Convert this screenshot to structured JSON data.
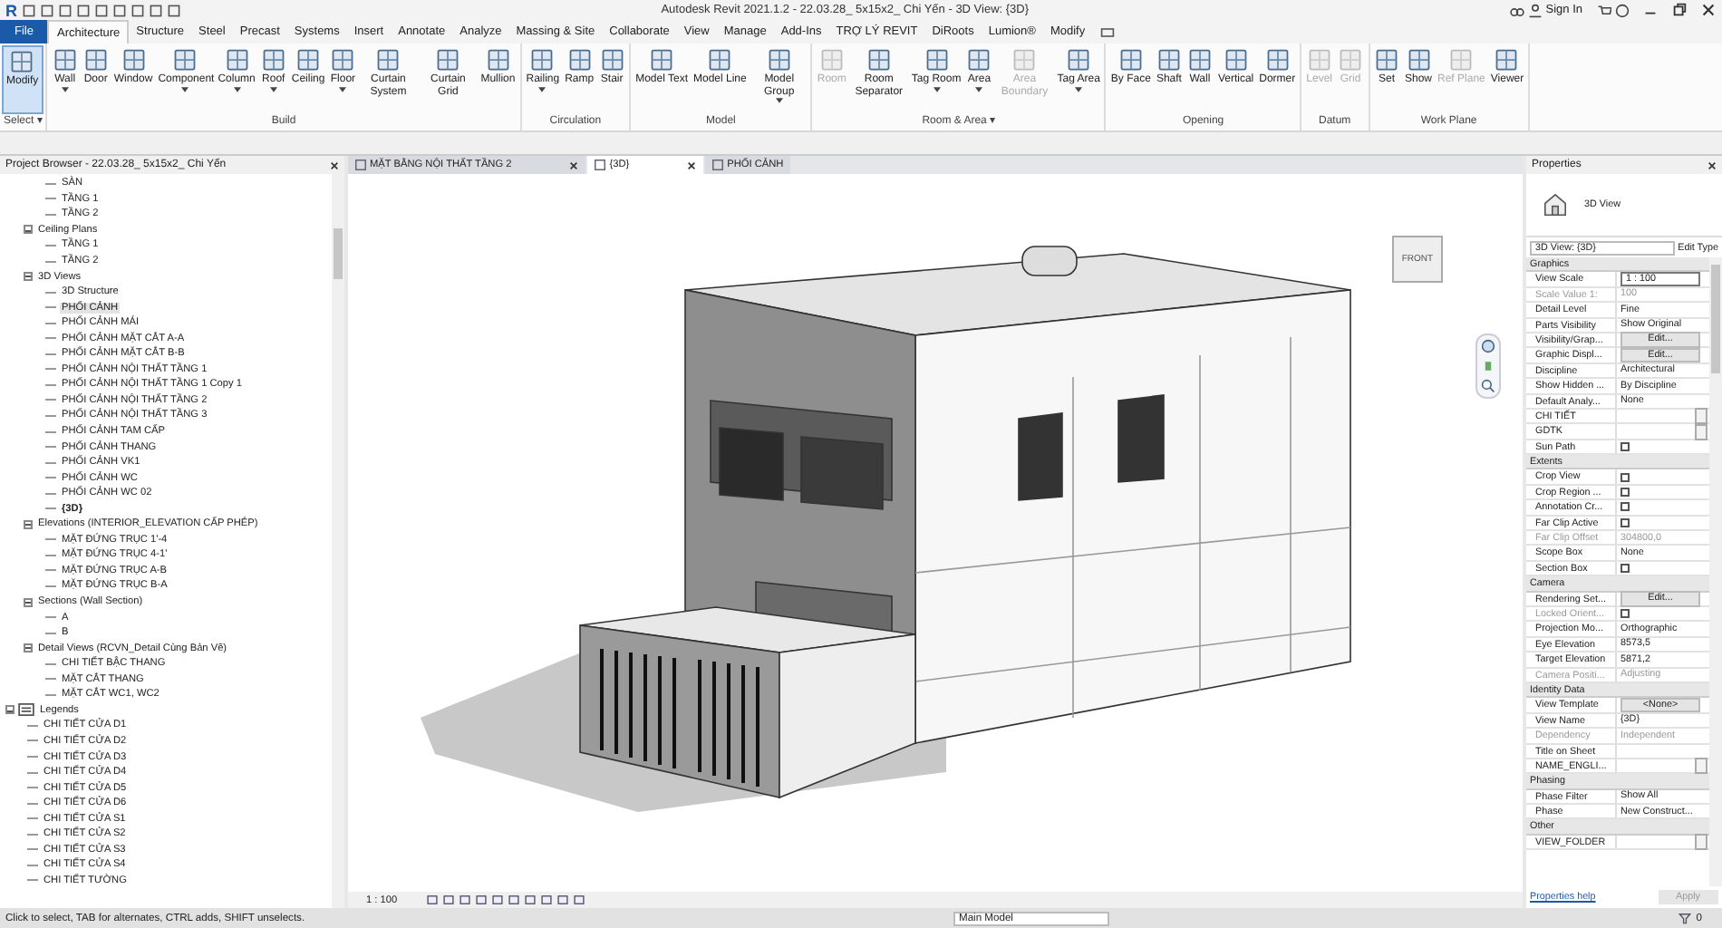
{
  "title_bar": {
    "logo": "R",
    "title": "Autodesk Revit 2021.1.2 - 22.03.28_ 5x15x2_ Chi Yến - 3D View: {3D}",
    "sign_in": "Sign In"
  },
  "menu_tabs": [
    {
      "label": "File",
      "kind": "file",
      "selected": false
    },
    {
      "label": "Architecture",
      "kind": "tab",
      "selected": true
    },
    {
      "label": "Structure",
      "kind": "tab",
      "selected": false
    },
    {
      "label": "Steel",
      "kind": "tab",
      "selected": false
    },
    {
      "label": "Precast",
      "kind": "tab",
      "selected": false
    },
    {
      "label": "Systems",
      "kind": "tab",
      "selected": false
    },
    {
      "label": "Insert",
      "kind": "tab",
      "selected": false
    },
    {
      "label": "Annotate",
      "kind": "tab",
      "selected": false
    },
    {
      "label": "Analyze",
      "kind": "tab",
      "selected": false
    },
    {
      "label": "Massing & Site",
      "kind": "tab",
      "selected": false
    },
    {
      "label": "Collaborate",
      "kind": "tab",
      "selected": false
    },
    {
      "label": "View",
      "kind": "tab",
      "selected": false
    },
    {
      "label": "Manage",
      "kind": "tab",
      "selected": false
    },
    {
      "label": "Add-Ins",
      "kind": "tab",
      "selected": false
    },
    {
      "label": "TRỢ LÝ REVIT",
      "kind": "tab",
      "selected": false
    },
    {
      "label": "DiRoots",
      "kind": "tab",
      "selected": false
    },
    {
      "label": "Lumion®",
      "kind": "tab",
      "selected": false
    },
    {
      "label": "Modify",
      "kind": "tab",
      "selected": false
    }
  ],
  "ribbon": [
    {
      "title": "Select ▾",
      "tools": [
        {
          "label": "Modify",
          "disabled": false,
          "dropdown": false,
          "selected": true
        }
      ]
    },
    {
      "title": "Build",
      "tools": [
        {
          "label": "Wall",
          "disabled": false,
          "dropdown": true,
          "selected": false
        },
        {
          "label": "Door",
          "disabled": false,
          "dropdown": false,
          "selected": false
        },
        {
          "label": "Window",
          "disabled": false,
          "dropdown": false,
          "selected": false
        },
        {
          "label": "Component",
          "disabled": false,
          "dropdown": true,
          "selected": false
        },
        {
          "label": "Column",
          "disabled": false,
          "dropdown": true,
          "selected": false
        },
        {
          "label": "Roof",
          "disabled": false,
          "dropdown": true,
          "selected": false
        },
        {
          "label": "Ceiling",
          "disabled": false,
          "dropdown": false,
          "selected": false
        },
        {
          "label": "Floor",
          "disabled": false,
          "dropdown": true,
          "selected": false
        },
        {
          "label": "Curtain System",
          "disabled": false,
          "dropdown": false,
          "selected": false
        },
        {
          "label": "Curtain Grid",
          "disabled": false,
          "dropdown": false,
          "selected": false
        },
        {
          "label": "Mullion",
          "disabled": false,
          "dropdown": false,
          "selected": false
        }
      ]
    },
    {
      "title": "Circulation",
      "tools": [
        {
          "label": "Railing",
          "disabled": false,
          "dropdown": true,
          "selected": false
        },
        {
          "label": "Ramp",
          "disabled": false,
          "dropdown": false,
          "selected": false
        },
        {
          "label": "Stair",
          "disabled": false,
          "dropdown": false,
          "selected": false
        }
      ]
    },
    {
      "title": "Model",
      "tools": [
        {
          "label": "Model Text",
          "disabled": false,
          "dropdown": false,
          "selected": false
        },
        {
          "label": "Model Line",
          "disabled": false,
          "dropdown": false,
          "selected": false
        },
        {
          "label": "Model Group",
          "disabled": false,
          "dropdown": true,
          "selected": false
        }
      ]
    },
    {
      "title": "Room & Area ▾",
      "tools": [
        {
          "label": "Room",
          "disabled": true,
          "dropdown": false,
          "selected": false
        },
        {
          "label": "Room Separator",
          "disabled": false,
          "dropdown": false,
          "selected": false
        },
        {
          "label": "Tag Room",
          "disabled": false,
          "dropdown": true,
          "selected": false
        },
        {
          "label": "Area",
          "disabled": false,
          "dropdown": true,
          "selected": false
        },
        {
          "label": "Area Boundary",
          "disabled": true,
          "dropdown": false,
          "selected": false
        },
        {
          "label": "Tag Area",
          "disabled": false,
          "dropdown": true,
          "selected": false
        }
      ]
    },
    {
      "title": "Opening",
      "tools": [
        {
          "label": "By Face",
          "disabled": false,
          "dropdown": false,
          "selected": false
        },
        {
          "label": "Shaft",
          "disabled": false,
          "dropdown": false,
          "selected": false
        },
        {
          "label": "Wall",
          "disabled": false,
          "dropdown": false,
          "selected": false
        },
        {
          "label": "Vertical",
          "disabled": false,
          "dropdown": false,
          "selected": false
        },
        {
          "label": "Dormer",
          "disabled": false,
          "dropdown": false,
          "selected": false
        }
      ]
    },
    {
      "title": "Datum",
      "tools": [
        {
          "label": "Level",
          "disabled": true,
          "dropdown": false,
          "selected": false
        },
        {
          "label": "Grid",
          "disabled": true,
          "dropdown": false,
          "selected": false
        }
      ]
    },
    {
      "title": "Work Plane",
      "tools": [
        {
          "label": "Set",
          "disabled": false,
          "dropdown": false,
          "selected": false
        },
        {
          "label": "Show",
          "disabled": false,
          "dropdown": false,
          "selected": false
        },
        {
          "label": "Ref Plane",
          "disabled": true,
          "dropdown": false,
          "selected": false
        },
        {
          "label": "Viewer",
          "disabled": false,
          "dropdown": false,
          "selected": false
        }
      ]
    }
  ],
  "project_browser": {
    "title": "Project Browser - 22.03.28_ 5x15x2_ Chi Yến",
    "tree": [
      {
        "children": [
          {
            "children": [
              {
                "label": "SÀN",
                "selected": false,
                "open": false
              },
              {
                "label": "TẦNG 1",
                "selected": false,
                "open": false
              },
              {
                "label": "TẦNG 2",
                "selected": false,
                "open": false
              }
            ]
          },
          {
            "label": "Ceiling Plans",
            "expanded": true,
            "children": [
              {
                "label": "TẦNG 1",
                "selected": false,
                "open": false
              },
              {
                "label": "TẦNG 2",
                "selected": false,
                "open": false
              }
            ]
          },
          {
            "label": "3D Views",
            "expanded": true,
            "children": [
              {
                "label": "3D Structure",
                "selected": false,
                "open": false
              },
              {
                "label": "PHỐI CẢNH",
                "selected": true,
                "open": false
              },
              {
                "label": "PHỐI CẢNH MÁI",
                "selected": false,
                "open": false
              },
              {
                "label": "PHỐI CẢNH MẶT CẮT A-A",
                "selected": false,
                "open": false
              },
              {
                "label": "PHỐI CẢNH MẶT CẮT B-B",
                "selected": false,
                "open": false
              },
              {
                "label": "PHỐI CẢNH NỘI THẤT TẦNG 1",
                "selected": false,
                "open": false
              },
              {
                "label": "PHỐI CẢNH NỘI THẤT TẦNG 1 Copy 1",
                "selected": false,
                "open": false
              },
              {
                "label": "PHỐI CẢNH NỘI THẤT TẦNG 2",
                "selected": false,
                "open": false
              },
              {
                "label": "PHỐI CẢNH NỘI THẤT TẦNG 3",
                "selected": false,
                "open": false
              },
              {
                "label": "PHỐI CẢNH TAM CẤP",
                "selected": false,
                "open": false
              },
              {
                "label": "PHỐI CẢNH THANG",
                "selected": false,
                "open": false
              },
              {
                "label": "PHỐI CẢNH VK1",
                "selected": false,
                "open": false
              },
              {
                "label": "PHỐI CẢNH WC",
                "selected": false,
                "open": false
              },
              {
                "label": "PHỐI CẢNH WC 02",
                "selected": false,
                "open": false
              },
              {
                "label": "{3D}",
                "selected": false,
                "open": true
              }
            ]
          },
          {
            "label": "Elevations (INTERIOR_ELEVATION CẤP PHÉP)",
            "expanded": true,
            "children": [
              {
                "label": "MẶT ĐỨNG TRỤC 1'-4",
                "selected": false,
                "open": false
              },
              {
                "label": "MẶT ĐỨNG TRỤC 4-1'",
                "selected": false,
                "open": false
              },
              {
                "label": "MẶT ĐỨNG TRỤC A-B",
                "selected": false,
                "open": false
              },
              {
                "label": "MẶT ĐỨNG TRỤC B-A",
                "selected": false,
                "open": false
              }
            ]
          },
          {
            "label": "Sections (Wall Section)",
            "expanded": true,
            "children": [
              {
                "label": "A",
                "selected": false,
                "open": false
              },
              {
                "label": "B",
                "selected": false,
                "open": false
              }
            ]
          },
          {
            "label": "Detail Views (RCVN_Detail Cùng Bản Vẽ)",
            "expanded": true,
            "children": [
              {
                "label": "CHI TIẾT BẬC THANG",
                "selected": false,
                "open": false
              },
              {
                "label": "MẶT CẮT THANG",
                "selected": false,
                "open": false
              },
              {
                "label": "MẶT CẮT WC1, WC2",
                "selected": false,
                "open": false
              }
            ]
          }
        ]
      },
      {
        "label": "Legends",
        "expanded": true,
        "kind": "legends",
        "children": [
          {
            "label": "CHI TIẾT CỬA D1",
            "selected": false,
            "open": false
          },
          {
            "label": "CHI TIẾT CỬA D2",
            "selected": false,
            "open": false
          },
          {
            "label": "CHI TIẾT CỬA D3",
            "selected": false,
            "open": false
          },
          {
            "label": "CHI TIẾT CỬA D4",
            "selected": false,
            "open": false
          },
          {
            "label": "CHI TIẾT CỬA D5",
            "selected": false,
            "open": false
          },
          {
            "label": "CHI TIẾT CỬA D6",
            "selected": false,
            "open": false
          },
          {
            "label": "CHI TIẾT CỬA S1",
            "selected": false,
            "open": false
          },
          {
            "label": "CHI TIẾT CỬA S2",
            "selected": false,
            "open": false
          },
          {
            "label": "CHI TIẾT CỬA S3",
            "selected": false,
            "open": false
          },
          {
            "label": "CHI TIẾT CỬA S4",
            "selected": false,
            "open": false
          },
          {
            "label": "CHI TIẾT TƯỜNG",
            "selected": false,
            "open": false
          }
        ]
      }
    ]
  },
  "view_tabs": [
    {
      "label": "MẶT BẰNG NỘI THẤT TẦNG 2",
      "selected": false,
      "closable": true
    },
    {
      "label": "{3D}",
      "selected": true,
      "closable": true
    },
    {
      "label": "PHỐI CẢNH",
      "selected": false,
      "closable": false
    }
  ],
  "view_cube": {
    "face": "FRONT"
  },
  "view_bar": {
    "scale": "1 : 100"
  },
  "properties": {
    "title": "Properties",
    "type_name": "3D View",
    "selector": "3D View: {3D}",
    "edit_type": "Edit Type",
    "sections": [
      {
        "title": "Graphics",
        "rows": [
          {
            "label": "View Scale",
            "kind": "field",
            "value": "1 : 100",
            "disabled": false
          },
          {
            "label": "Scale Value    1:",
            "kind": "text",
            "value": "100",
            "disabled": true
          },
          {
            "label": "Detail Level",
            "kind": "text",
            "value": "Fine",
            "disabled": false
          },
          {
            "label": "Parts Visibility",
            "kind": "text",
            "value": "Show Original",
            "disabled": false
          },
          {
            "label": "Visibility/Grap...",
            "kind": "button",
            "value": "Edit...",
            "disabled": false
          },
          {
            "label": "Graphic Displ...",
            "kind": "button",
            "value": "Edit...",
            "disabled": false
          },
          {
            "label": "Discipline",
            "kind": "text",
            "value": "Architectural",
            "disabled": false
          },
          {
            "label": "Show Hidden ...",
            "kind": "text",
            "value": "By Discipline",
            "disabled": false
          },
          {
            "label": "Default Analy...",
            "kind": "text",
            "value": "None",
            "disabled": false
          },
          {
            "label": "CHI TIẾT",
            "kind": "picker",
            "disabled": false
          },
          {
            "label": "GDTK",
            "kind": "picker",
            "disabled": false
          },
          {
            "label": "Sun Path",
            "kind": "checkbox",
            "checked": false,
            "disabled": false
          }
        ]
      },
      {
        "title": "Extents",
        "rows": [
          {
            "label": "Crop View",
            "kind": "checkbox",
            "checked": false,
            "disabled": false
          },
          {
            "label": "Crop Region ...",
            "kind": "checkbox",
            "checked": false,
            "disabled": false
          },
          {
            "label": "Annotation Cr...",
            "kind": "checkbox",
            "checked": false,
            "disabled": false
          },
          {
            "label": "Far Clip Active",
            "kind": "checkbox",
            "checked": false,
            "disabled": false
          },
          {
            "label": "Far Clip Offset",
            "kind": "text",
            "value": "304800,0",
            "disabled": true
          },
          {
            "label": "Scope Box",
            "kind": "text",
            "value": "None",
            "disabled": false
          },
          {
            "label": "Section Box",
            "kind": "checkbox",
            "checked": false,
            "disabled": false
          }
        ]
      },
      {
        "title": "Camera",
        "rows": [
          {
            "label": "Rendering Set...",
            "kind": "button",
            "value": "Edit...",
            "disabled": false
          },
          {
            "label": "Locked Orient...",
            "kind": "checkbox",
            "checked": false,
            "disabled": true
          },
          {
            "label": "Projection Mo...",
            "kind": "text",
            "value": "Orthographic",
            "disabled": false
          },
          {
            "label": "Eye Elevation",
            "kind": "text",
            "value": "8573,5",
            "disabled": false
          },
          {
            "label": "Target Elevation",
            "kind": "text",
            "value": "5871,2",
            "disabled": false
          },
          {
            "label": "Camera Positi...",
            "kind": "text",
            "value": "Adjusting",
            "disabled": true
          }
        ]
      },
      {
        "title": "Identity Data",
        "rows": [
          {
            "label": "View Template",
            "kind": "button",
            "value": "<None>",
            "disabled": false
          },
          {
            "label": "View Name",
            "kind": "text",
            "value": "{3D}",
            "disabled": false
          },
          {
            "label": "Dependency",
            "kind": "text",
            "value": "Independent",
            "disabled": true
          },
          {
            "label": "Title on Sheet",
            "kind": "text",
            "value": "",
            "disabled": false
          },
          {
            "label": "NAME_ENGLI...",
            "kind": "picker",
            "disabled": false
          }
        ]
      },
      {
        "title": "Phasing",
        "rows": [
          {
            "label": "Phase Filter",
            "kind": "text",
            "value": "Show All",
            "disabled": false
          },
          {
            "label": "Phase",
            "kind": "text",
            "value": "New Construct...",
            "disabled": false
          }
        ]
      },
      {
        "title": "Other",
        "rows": [
          {
            "label": "VIEW_FOLDER",
            "kind": "picker",
            "disabled": false
          }
        ]
      }
    ],
    "help": "Properties help",
    "apply": "Apply"
  },
  "status_bar": {
    "message": "Click to select, TAB for alternates, CTRL adds, SHIFT unselects.",
    "model": "Main Model",
    "filter_count": "0"
  }
}
